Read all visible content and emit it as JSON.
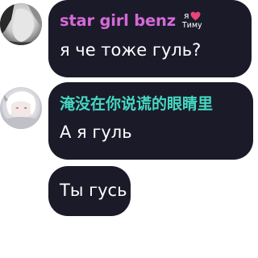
{
  "messages": [
    {
      "sender": "star girl benz",
      "sender_color": "#d46ad7",
      "badge": {
        "top": "я",
        "bottom": "Тиму",
        "icon": "heart-icon",
        "icon_color": "#e8447a"
      },
      "text": "я че тоже гуль?"
    },
    {
      "sender": "淹没在你说谎的眼睛里",
      "sender_color": "#45d8c2",
      "text": "А я гуль"
    },
    {
      "text": "Ты гусь"
    }
  ],
  "colors": {
    "bubble": "#1b1a29",
    "text": "#ffffff",
    "background": "#ffffff"
  }
}
